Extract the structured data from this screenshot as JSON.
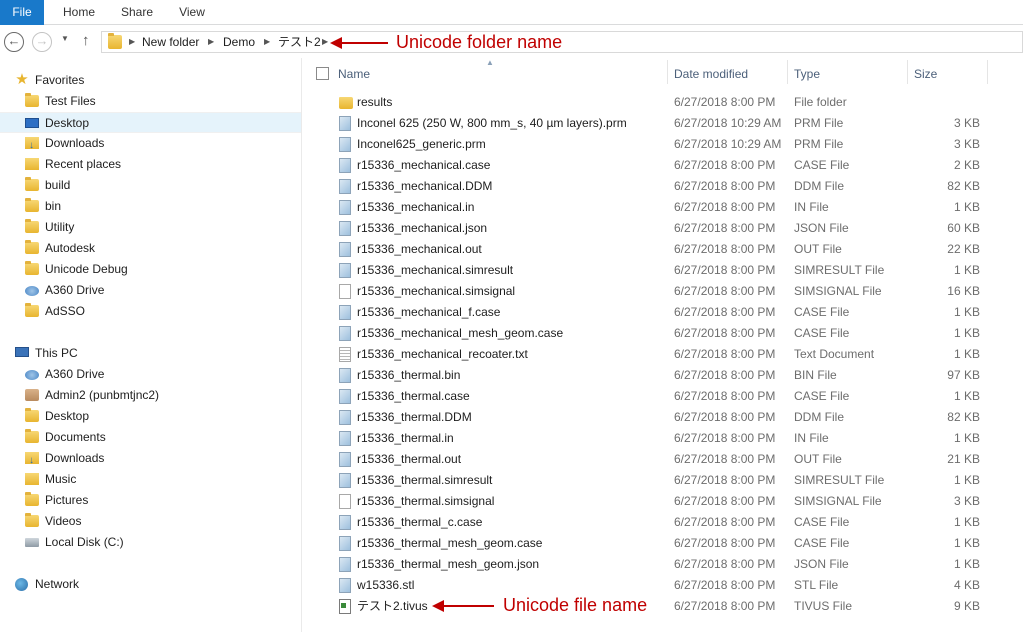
{
  "ribbon": {
    "tabs": [
      "File",
      "Home",
      "Share",
      "View"
    ]
  },
  "address": {
    "crumbs": [
      "New folder",
      "Demo",
      "テスト2"
    ]
  },
  "annotations": {
    "folder_note": "Unicode folder name",
    "file_note": "Unicode file name",
    "color": "#c00000"
  },
  "navigation": {
    "favorites_label": "Favorites",
    "favorites": [
      {
        "label": "Test Files",
        "icon": "folder-icon"
      },
      {
        "label": "Desktop",
        "icon": "desktop-icon",
        "selected": true
      },
      {
        "label": "Downloads",
        "icon": "downloads-icon"
      },
      {
        "label": "Recent places",
        "icon": "recent-places-icon"
      },
      {
        "label": "build",
        "icon": "folder-icon"
      },
      {
        "label": "bin",
        "icon": "folder-icon"
      },
      {
        "label": "Utility",
        "icon": "folder-icon"
      },
      {
        "label": "Autodesk",
        "icon": "folder-icon"
      },
      {
        "label": "Unicode Debug",
        "icon": "folder-icon"
      },
      {
        "label": "A360 Drive",
        "icon": "cloud-drive-icon"
      },
      {
        "label": "AdSSO",
        "icon": "folder-icon"
      }
    ],
    "this_pc_label": "This PC",
    "this_pc": [
      {
        "label": "A360 Drive",
        "icon": "cloud-drive-icon"
      },
      {
        "label": "Admin2 (punbmtjnc2)",
        "icon": "user-folder-icon"
      },
      {
        "label": "Desktop",
        "icon": "folder-icon"
      },
      {
        "label": "Documents",
        "icon": "folder-icon"
      },
      {
        "label": "Downloads",
        "icon": "downloads-icon"
      },
      {
        "label": "Music",
        "icon": "music-icon"
      },
      {
        "label": "Pictures",
        "icon": "folder-icon"
      },
      {
        "label": "Videos",
        "icon": "folder-icon"
      },
      {
        "label": "Local Disk (C:)",
        "icon": "disk-icon"
      }
    ],
    "network_label": "Network"
  },
  "columns": {
    "name": "Name",
    "date": "Date modified",
    "type": "Type",
    "size": "Size"
  },
  "files": [
    {
      "name": "results",
      "date": "6/27/2018 8:00 PM",
      "type": "File folder",
      "size": "",
      "icon": "folder"
    },
    {
      "name": "Inconel 625 (250 W, 800 mm_s, 40 µm layers).prm",
      "date": "6/27/2018 10:29 AM",
      "type": "PRM File",
      "size": "3 KB",
      "icon": "doc"
    },
    {
      "name": "Inconel625_generic.prm",
      "date": "6/27/2018 10:29 AM",
      "type": "PRM File",
      "size": "3 KB",
      "icon": "doc"
    },
    {
      "name": "r15336_mechanical.case",
      "date": "6/27/2018 8:00 PM",
      "type": "CASE File",
      "size": "2 KB",
      "icon": "doc"
    },
    {
      "name": "r15336_mechanical.DDM",
      "date": "6/27/2018 8:00 PM",
      "type": "DDM File",
      "size": "82 KB",
      "icon": "doc"
    },
    {
      "name": "r15336_mechanical.in",
      "date": "6/27/2018 8:00 PM",
      "type": "IN File",
      "size": "1 KB",
      "icon": "doc"
    },
    {
      "name": "r15336_mechanical.json",
      "date": "6/27/2018 8:00 PM",
      "type": "JSON File",
      "size": "60 KB",
      "icon": "doc"
    },
    {
      "name": "r15336_mechanical.out",
      "date": "6/27/2018 8:00 PM",
      "type": "OUT File",
      "size": "22 KB",
      "icon": "doc"
    },
    {
      "name": "r15336_mechanical.simresult",
      "date": "6/27/2018 8:00 PM",
      "type": "SIMRESULT File",
      "size": "1 KB",
      "icon": "doc"
    },
    {
      "name": "r15336_mechanical.simsignal",
      "date": "6/27/2018 8:00 PM",
      "type": "SIMSIGNAL File",
      "size": "16 KB",
      "icon": "blank"
    },
    {
      "name": "r15336_mechanical_f.case",
      "date": "6/27/2018 8:00 PM",
      "type": "CASE File",
      "size": "1 KB",
      "icon": "doc"
    },
    {
      "name": "r15336_mechanical_mesh_geom.case",
      "date": "6/27/2018 8:00 PM",
      "type": "CASE File",
      "size": "1 KB",
      "icon": "doc"
    },
    {
      "name": "r15336_mechanical_recoater.txt",
      "date": "6/27/2018 8:00 PM",
      "type": "Text Document",
      "size": "1 KB",
      "icon": "text"
    },
    {
      "name": "r15336_thermal.bin",
      "date": "6/27/2018 8:00 PM",
      "type": "BIN File",
      "size": "97 KB",
      "icon": "doc"
    },
    {
      "name": "r15336_thermal.case",
      "date": "6/27/2018 8:00 PM",
      "type": "CASE File",
      "size": "1 KB",
      "icon": "doc"
    },
    {
      "name": "r15336_thermal.DDM",
      "date": "6/27/2018 8:00 PM",
      "type": "DDM File",
      "size": "82 KB",
      "icon": "doc"
    },
    {
      "name": "r15336_thermal.in",
      "date": "6/27/2018 8:00 PM",
      "type": "IN File",
      "size": "1 KB",
      "icon": "doc"
    },
    {
      "name": "r15336_thermal.out",
      "date": "6/27/2018 8:00 PM",
      "type": "OUT File",
      "size": "21 KB",
      "icon": "doc"
    },
    {
      "name": "r15336_thermal.simresult",
      "date": "6/27/2018 8:00 PM",
      "type": "SIMRESULT File",
      "size": "1 KB",
      "icon": "doc"
    },
    {
      "name": "r15336_thermal.simsignal",
      "date": "6/27/2018 8:00 PM",
      "type": "SIMSIGNAL File",
      "size": "3 KB",
      "icon": "blank"
    },
    {
      "name": "r15336_thermal_c.case",
      "date": "6/27/2018 8:00 PM",
      "type": "CASE File",
      "size": "1 KB",
      "icon": "doc"
    },
    {
      "name": "r15336_thermal_mesh_geom.case",
      "date": "6/27/2018 8:00 PM",
      "type": "CASE File",
      "size": "1 KB",
      "icon": "doc"
    },
    {
      "name": "r15336_thermal_mesh_geom.json",
      "date": "6/27/2018 8:00 PM",
      "type": "JSON File",
      "size": "1 KB",
      "icon": "doc"
    },
    {
      "name": "w15336.stl",
      "date": "6/27/2018 8:00 PM",
      "type": "STL File",
      "size": "4 KB",
      "icon": "doc"
    },
    {
      "name": "テスト2.tivus",
      "date": "6/27/2018 8:00 PM",
      "type": "TIVUS File",
      "size": "9 KB",
      "icon": "app"
    }
  ]
}
